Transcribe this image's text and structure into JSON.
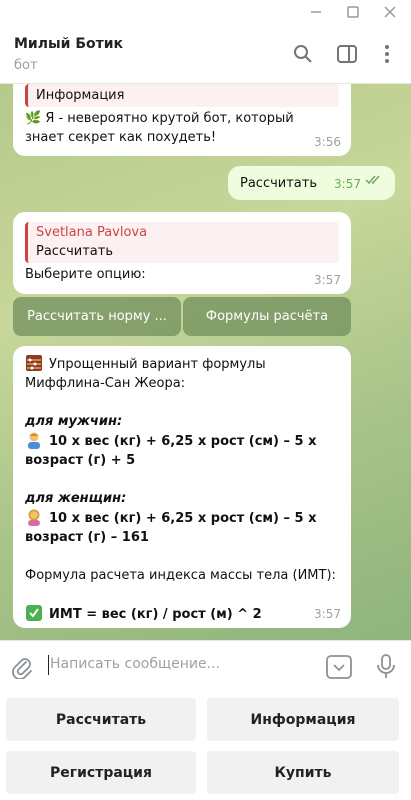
{
  "window": {
    "minimize_icon": "minimize-icon",
    "maximize_icon": "maximize-icon",
    "close_icon": "close-icon"
  },
  "header": {
    "title": "Милый Ботик",
    "subtitle": "бот"
  },
  "messages": {
    "m1": {
      "quote_text": "Информация",
      "text": "🌿 Я - невероятно крутой бот, который знает секрет как похудеть!",
      "time": "3:56"
    },
    "m2": {
      "text": "Рассчитать",
      "time": "3:57"
    },
    "m3": {
      "quote_name": "Svetlana Pavlova",
      "quote_text": "Рассчитать",
      "text": "Выберите опцию:",
      "time": "3:57"
    },
    "inline_buttons": {
      "left": "Рассчитать норму ...",
      "right": "Формулы расчёта"
    },
    "m4": {
      "line1": "Упрощенный вариант формулы Миффлина-Сан Жеора:",
      "men_label": "для мужчин:",
      "men_formula": "10 x вес (кг) + 6,25 x рост (см) – 5 x возраст (г) + 5",
      "women_label": "для женщин:",
      "women_formula": "10 x вес (кг) + 6,25 x рост (см) – 5 x возраст (г) – 161",
      "bmi_intro": "Формула расчета индекса массы тела (ИМТ):",
      "bmi_formula": "ИМТ = вес (кг) / рост (м) ^ 2",
      "time": "3:57"
    }
  },
  "composer": {
    "placeholder": "Написать сообщение..."
  },
  "keyboard": {
    "b1": "Рассчитать",
    "b2": "Информация",
    "b3": "Регистрация",
    "b4": "Купить"
  },
  "colors": {
    "outgoing_bubble": "#effdde",
    "quote_accent": "#c94545",
    "read_check": "#6cab5e"
  }
}
